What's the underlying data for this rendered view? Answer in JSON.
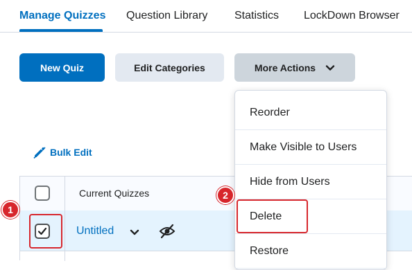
{
  "tabs": [
    {
      "label": "Manage Quizzes",
      "active": true
    },
    {
      "label": "Question Library",
      "active": false
    },
    {
      "label": "Statistics",
      "active": false
    },
    {
      "label": "LockDown Browser",
      "active": false
    }
  ],
  "toolbar": {
    "new_quiz_label": "New Quiz",
    "edit_categories_label": "Edit Categories",
    "more_actions_label": "More Actions"
  },
  "bulk_edit": {
    "label": "Bulk Edit",
    "icon": "pencil-icon"
  },
  "table": {
    "header": "Current Quizzes",
    "rows": [
      {
        "title": "Untitled",
        "checked": true,
        "visibility_icon": "eye-slash-icon"
      }
    ]
  },
  "more_actions_menu": {
    "items": [
      "Reorder",
      "Make Visible to Users",
      "Hide from Users",
      "Delete",
      "Restore"
    ]
  },
  "callouts": [
    {
      "number": "1",
      "target": "row-checkbox"
    },
    {
      "number": "2",
      "target": "delete-menu-item"
    }
  ],
  "colors": {
    "accent": "#006fbf",
    "highlight": "#d7262c",
    "selected_row": "#e4f3fe"
  }
}
